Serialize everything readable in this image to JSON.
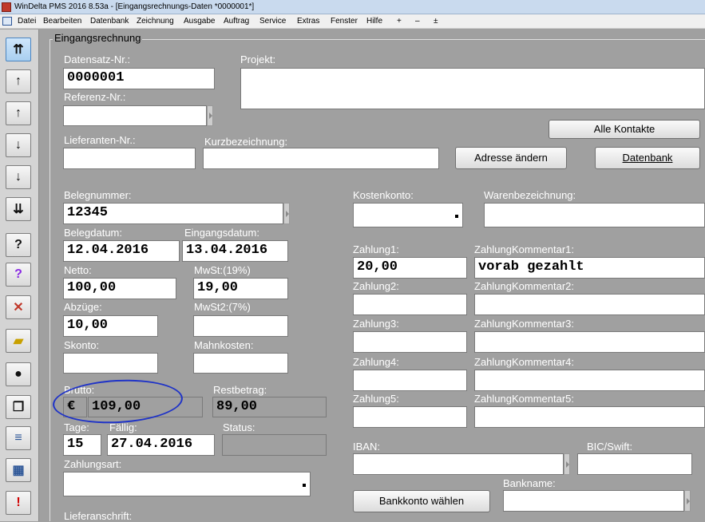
{
  "window": {
    "title": "WinDelta PMS 2016 8.53a - [Eingangsrechnungs-Daten *0000001*]"
  },
  "menu": [
    "Datei",
    "Bearbeiten",
    "Datenbank",
    "Zeichnung",
    "Ausgabe",
    "Auftrag",
    "Service",
    "Extras",
    "Fenster",
    "Hilfe",
    "+",
    "–",
    "±"
  ],
  "toolbar": {
    "buttons": [
      "nav-first",
      "nav-prev-page",
      "nav-prev",
      "nav-next",
      "nav-next-page",
      "nav-last",
      "help",
      "help-edit",
      "delete",
      "open-folder",
      "bomb",
      "copy",
      "list",
      "table",
      "alert"
    ]
  },
  "section": {
    "title": "Eingangsrechnung"
  },
  "form": {
    "datensatz_label": "Datensatz-Nr.:",
    "datensatz_value": "0000001",
    "projekt_label": "Projekt:",
    "referenz_label": "Referenz-Nr.:",
    "lieferanten_label": "Lieferanten-Nr.:",
    "kurzbez_label": "Kurzbezeichnung:",
    "alle_kontakte": "Alle Kontakte",
    "adresse_aendern": "Adresse ändern",
    "datenbank": "Datenbank",
    "beleg_label": "Belegnummer:",
    "beleg_value": "12345",
    "kostenkonto_label": "Kostenkonto:",
    "warenbez_label": "Warenbezeichnung:",
    "belegdatum_label": "Belegdatum:",
    "belegdatum_value": "12.04.2016",
    "eingangsdatum_label": "Eingangsdatum:",
    "eingangsdatum_value": "13.04.2016",
    "netto_label": "Netto:",
    "netto_value": "100,00",
    "mwst_label": "MwSt:(19%)",
    "mwst_value": "19,00",
    "abzuege_label": "Abzüge:",
    "abzuege_value": "10,00",
    "mwst2_label": "MwSt2:(7%)",
    "skonto_label": "Skonto:",
    "mahnkosten_label": "Mahnkosten:",
    "brutto_label": "Brutto:",
    "currency": "€",
    "brutto_value": "109,00",
    "restbetrag_label": "Restbetrag:",
    "restbetrag_value": "89,00",
    "tage_label": "Tage:",
    "tage_value": "15",
    "faellig_label": "Fällig:",
    "faellig_value": "27.04.2016",
    "status_label": "Status:",
    "zahlungsart_label": "Zahlungsart:",
    "lieferanschrift_label": "Lieferanschrift:",
    "iban_label": "IBAN:",
    "bic_label": "BIC/Swift:",
    "bankname_label": "Bankname:",
    "bankkonto_waehlen": "Bankkonto wählen"
  },
  "payments": [
    {
      "label": "Zahlung1:",
      "value": "20,00",
      "comment_label": "ZahlungKommentar1:",
      "comment": "vorab gezahlt"
    },
    {
      "label": "Zahlung2:",
      "value": "",
      "comment_label": "ZahlungKommentar2:",
      "comment": ""
    },
    {
      "label": "Zahlung3:",
      "value": "",
      "comment_label": "ZahlungKommentar3:",
      "comment": ""
    },
    {
      "label": "Zahlung4:",
      "value": "",
      "comment_label": "ZahlungKommentar4:",
      "comment": ""
    },
    {
      "label": "Zahlung5:",
      "value": "",
      "comment_label": "ZahlungKommentar5:",
      "comment": ""
    }
  ],
  "colors": {
    "background": "#a0a0a0",
    "annotation": "#1f33c7",
    "label": "#ffffff"
  }
}
